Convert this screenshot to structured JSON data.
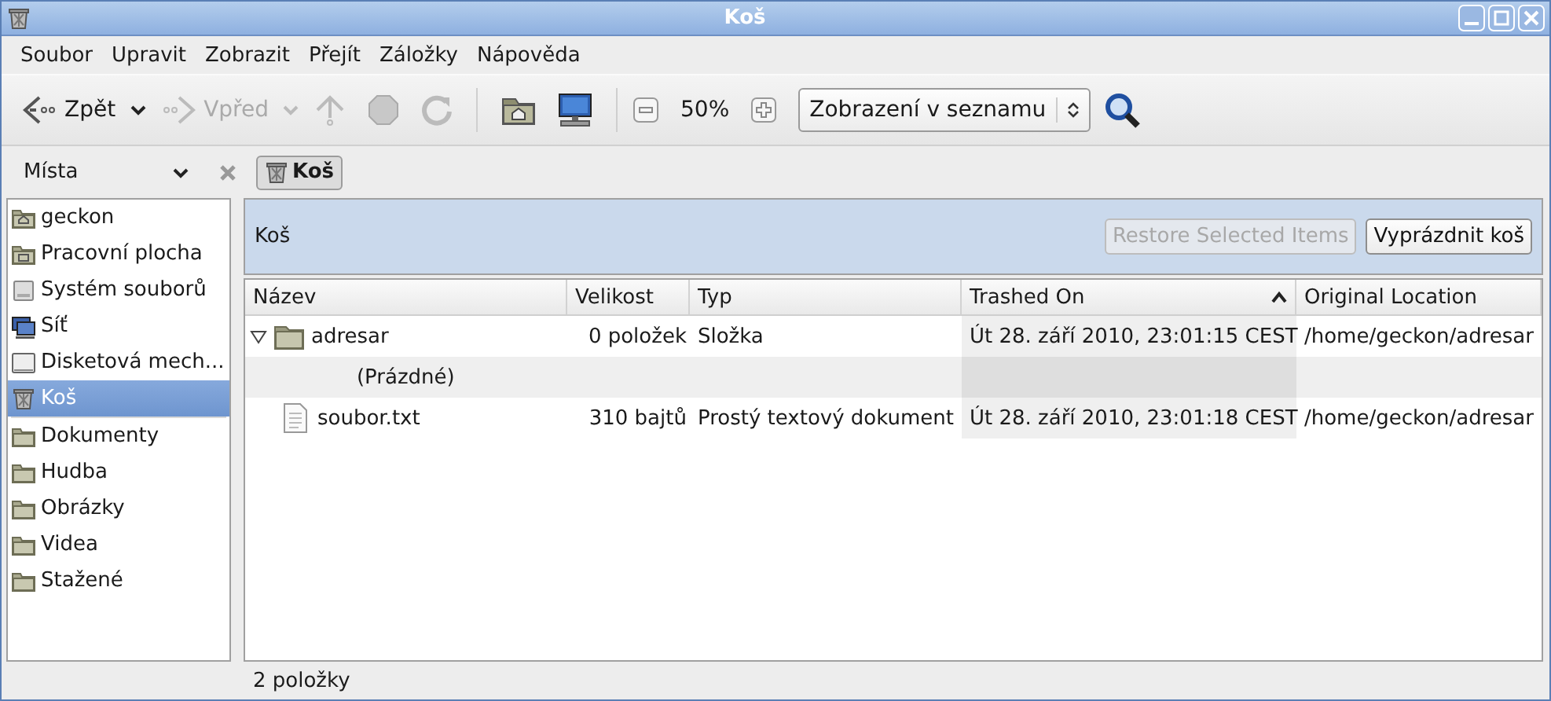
{
  "window": {
    "title": "Koš"
  },
  "menu": [
    {
      "label": "Soubor"
    },
    {
      "label": "Upravit"
    },
    {
      "label": "Zobrazit"
    },
    {
      "label": "Přejít"
    },
    {
      "label": "Záložky"
    },
    {
      "label": "Nápověda"
    }
  ],
  "toolbar": {
    "back": {
      "label": "Zpět",
      "disabled": false
    },
    "forward": {
      "label": "Vpřed",
      "disabled": true
    },
    "up": {
      "disabled": true
    },
    "stop": {
      "disabled": true
    },
    "reload": {
      "disabled": true
    },
    "zoom": "50%",
    "view_mode": "Zobrazení v seznamu"
  },
  "sidebar": {
    "title": "Místa",
    "items": [
      {
        "label": "geckon",
        "kind": "home",
        "selected": false
      },
      {
        "label": "Pracovní plocha",
        "kind": "desktop",
        "selected": false
      },
      {
        "label": "Systém souborů",
        "kind": "drive",
        "selected": false
      },
      {
        "label": "Síť",
        "kind": "network",
        "selected": false
      },
      {
        "label": "Disketová mech...",
        "kind": "floppy",
        "selected": false
      },
      {
        "label": "Koš",
        "kind": "trash",
        "selected": true
      }
    ],
    "bookmarks": [
      {
        "label": "Dokumenty",
        "kind": "folder",
        "selected": false
      },
      {
        "label": "Hudba",
        "kind": "folder",
        "selected": false
      },
      {
        "label": "Obrázky",
        "kind": "folder",
        "selected": false
      },
      {
        "label": "Videa",
        "kind": "folder",
        "selected": false
      },
      {
        "label": "Stažené",
        "kind": "folder",
        "selected": false
      }
    ]
  },
  "location": {
    "button": "Koš"
  },
  "info_bar": {
    "title": "Koš",
    "buttons": [
      {
        "label": "Restore Selected Items",
        "disabled": true
      },
      {
        "label": "Vyprázdnit koš",
        "disabled": false
      }
    ]
  },
  "table": {
    "columns": [
      {
        "label": "Název",
        "sorted": false
      },
      {
        "label": "Velikost",
        "sorted": false
      },
      {
        "label": "Typ",
        "sorted": false
      },
      {
        "label": "Trashed On",
        "sorted": true
      },
      {
        "label": "Original Location",
        "sorted": false
      }
    ],
    "rows": [
      {
        "kind": "folder",
        "expanded": true,
        "cells": [
          "adresar",
          "0 položek",
          "Složka",
          "Út 28. září 2010, 23:01:15 CEST",
          "/home/geckon/adresar"
        ]
      },
      {
        "kind": "empty",
        "cells": [
          "(Prázdné)"
        ]
      },
      {
        "kind": "file",
        "cells": [
          "soubor.txt",
          "310 bajtů",
          "Prostý textový dokument",
          "Út 28. září 2010, 23:01:18 CEST",
          "/home/geckon/adresar"
        ]
      }
    ]
  },
  "status_bar": "2 položky"
}
